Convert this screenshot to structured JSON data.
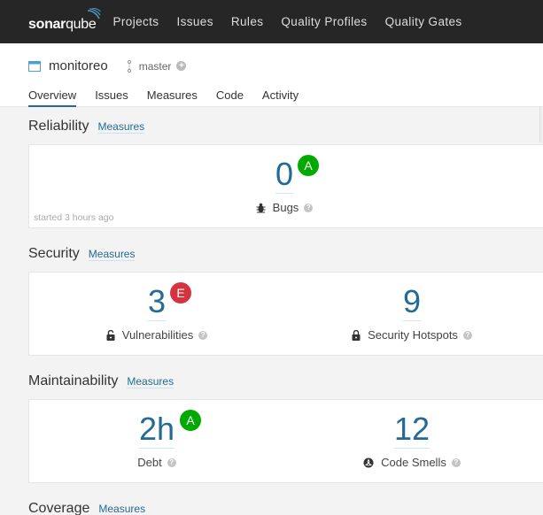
{
  "nav": {
    "logo_bold": "sonar",
    "logo_light": "qube",
    "links": [
      "Projects",
      "Issues",
      "Rules",
      "Quality Profiles",
      "Quality Gates"
    ]
  },
  "project": {
    "name": "monitoreo",
    "branch": "master",
    "tabs": [
      "Overview",
      "Issues",
      "Measures",
      "Code",
      "Activity"
    ],
    "active_tab": "Overview"
  },
  "sections": {
    "reliability": {
      "title": "Reliability",
      "link": "Measures",
      "bugs": {
        "value": "0",
        "rating": "A",
        "label": "Bugs"
      },
      "started": "started 3 hours ago"
    },
    "security": {
      "title": "Security",
      "link": "Measures",
      "vulnerabilities": {
        "value": "3",
        "rating": "E",
        "label": "Vulnerabilities"
      },
      "hotspots": {
        "value": "9",
        "label": "Security Hotspots"
      }
    },
    "maintainability": {
      "title": "Maintainability",
      "link": "Measures",
      "debt": {
        "value": "2h",
        "rating": "A",
        "label": "Debt"
      },
      "smells": {
        "value": "12",
        "label": "Code Smells"
      }
    },
    "coverage": {
      "title": "Coverage",
      "link": "Measures"
    }
  },
  "colors": {
    "rating_a": "#00aa00",
    "rating_e": "#d4333f",
    "link": "#236a97",
    "topbar": "#262626"
  }
}
